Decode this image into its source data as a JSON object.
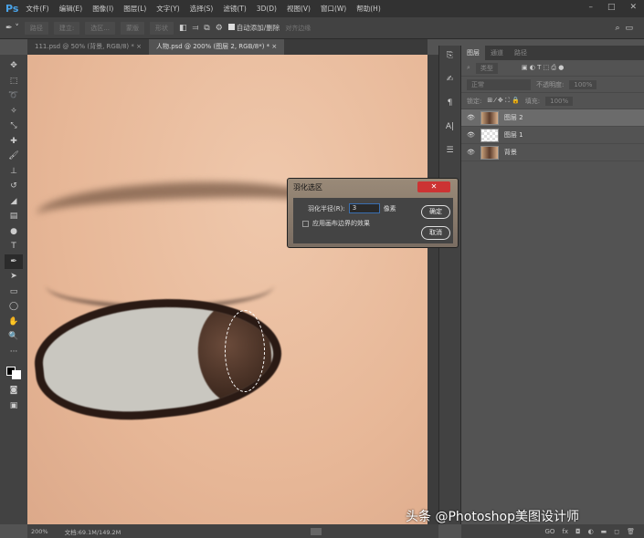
{
  "app": {
    "logo": "Ps",
    "menu": [
      "文件(F)",
      "编辑(E)",
      "图像(I)",
      "图层(L)",
      "文字(Y)",
      "选择(S)",
      "滤镜(T)",
      "3D(D)",
      "视图(V)",
      "窗口(W)",
      "帮助(H)"
    ],
    "window_buttons": [
      "–",
      "□",
      "✕"
    ]
  },
  "options": {
    "fields": [
      "路径",
      "建立:",
      "选区...",
      "蒙版",
      "形状"
    ],
    "auto_add_delete": "自动添加/删除",
    "align_edges": "对齐边缘"
  },
  "tabs": [
    {
      "label": "111.psd @ 50% (背景, RGB/8) * ×"
    },
    {
      "label": "人物.psd @ 200% (图层 2, RGB/8*) * ×"
    }
  ],
  "panel": {
    "tabs": [
      "图层",
      "通道",
      "路径"
    ],
    "filter_placeholder": "类型",
    "blend_mode": "正常",
    "opacity_label": "不透明度:",
    "opacity": "100%",
    "lock_label": "锁定:",
    "fill_label": "填充:",
    "fill": "100%",
    "layers": [
      {
        "name": "图层 2",
        "selected": true,
        "thumb": "photo"
      },
      {
        "name": "图层 1",
        "selected": false,
        "thumb": "trans"
      },
      {
        "name": "背景",
        "selected": false,
        "thumb": "photo"
      }
    ],
    "bottom_icons": [
      "GO",
      "fx",
      "◘",
      "◐",
      "▬",
      "◻",
      "🗑"
    ]
  },
  "status": {
    "zoom": "200%",
    "doc": "文档:69.1M/149.2M"
  },
  "dialog": {
    "title": "羽化选区",
    "close": "✕",
    "radius_label": "羽化半径(R):",
    "radius_value": "3",
    "unit": "像素",
    "canvas_bounds": "应用画布边界的效果",
    "ok": "确定",
    "cancel": "取消"
  },
  "watermark": "头条 @Photoshop美图设计师"
}
